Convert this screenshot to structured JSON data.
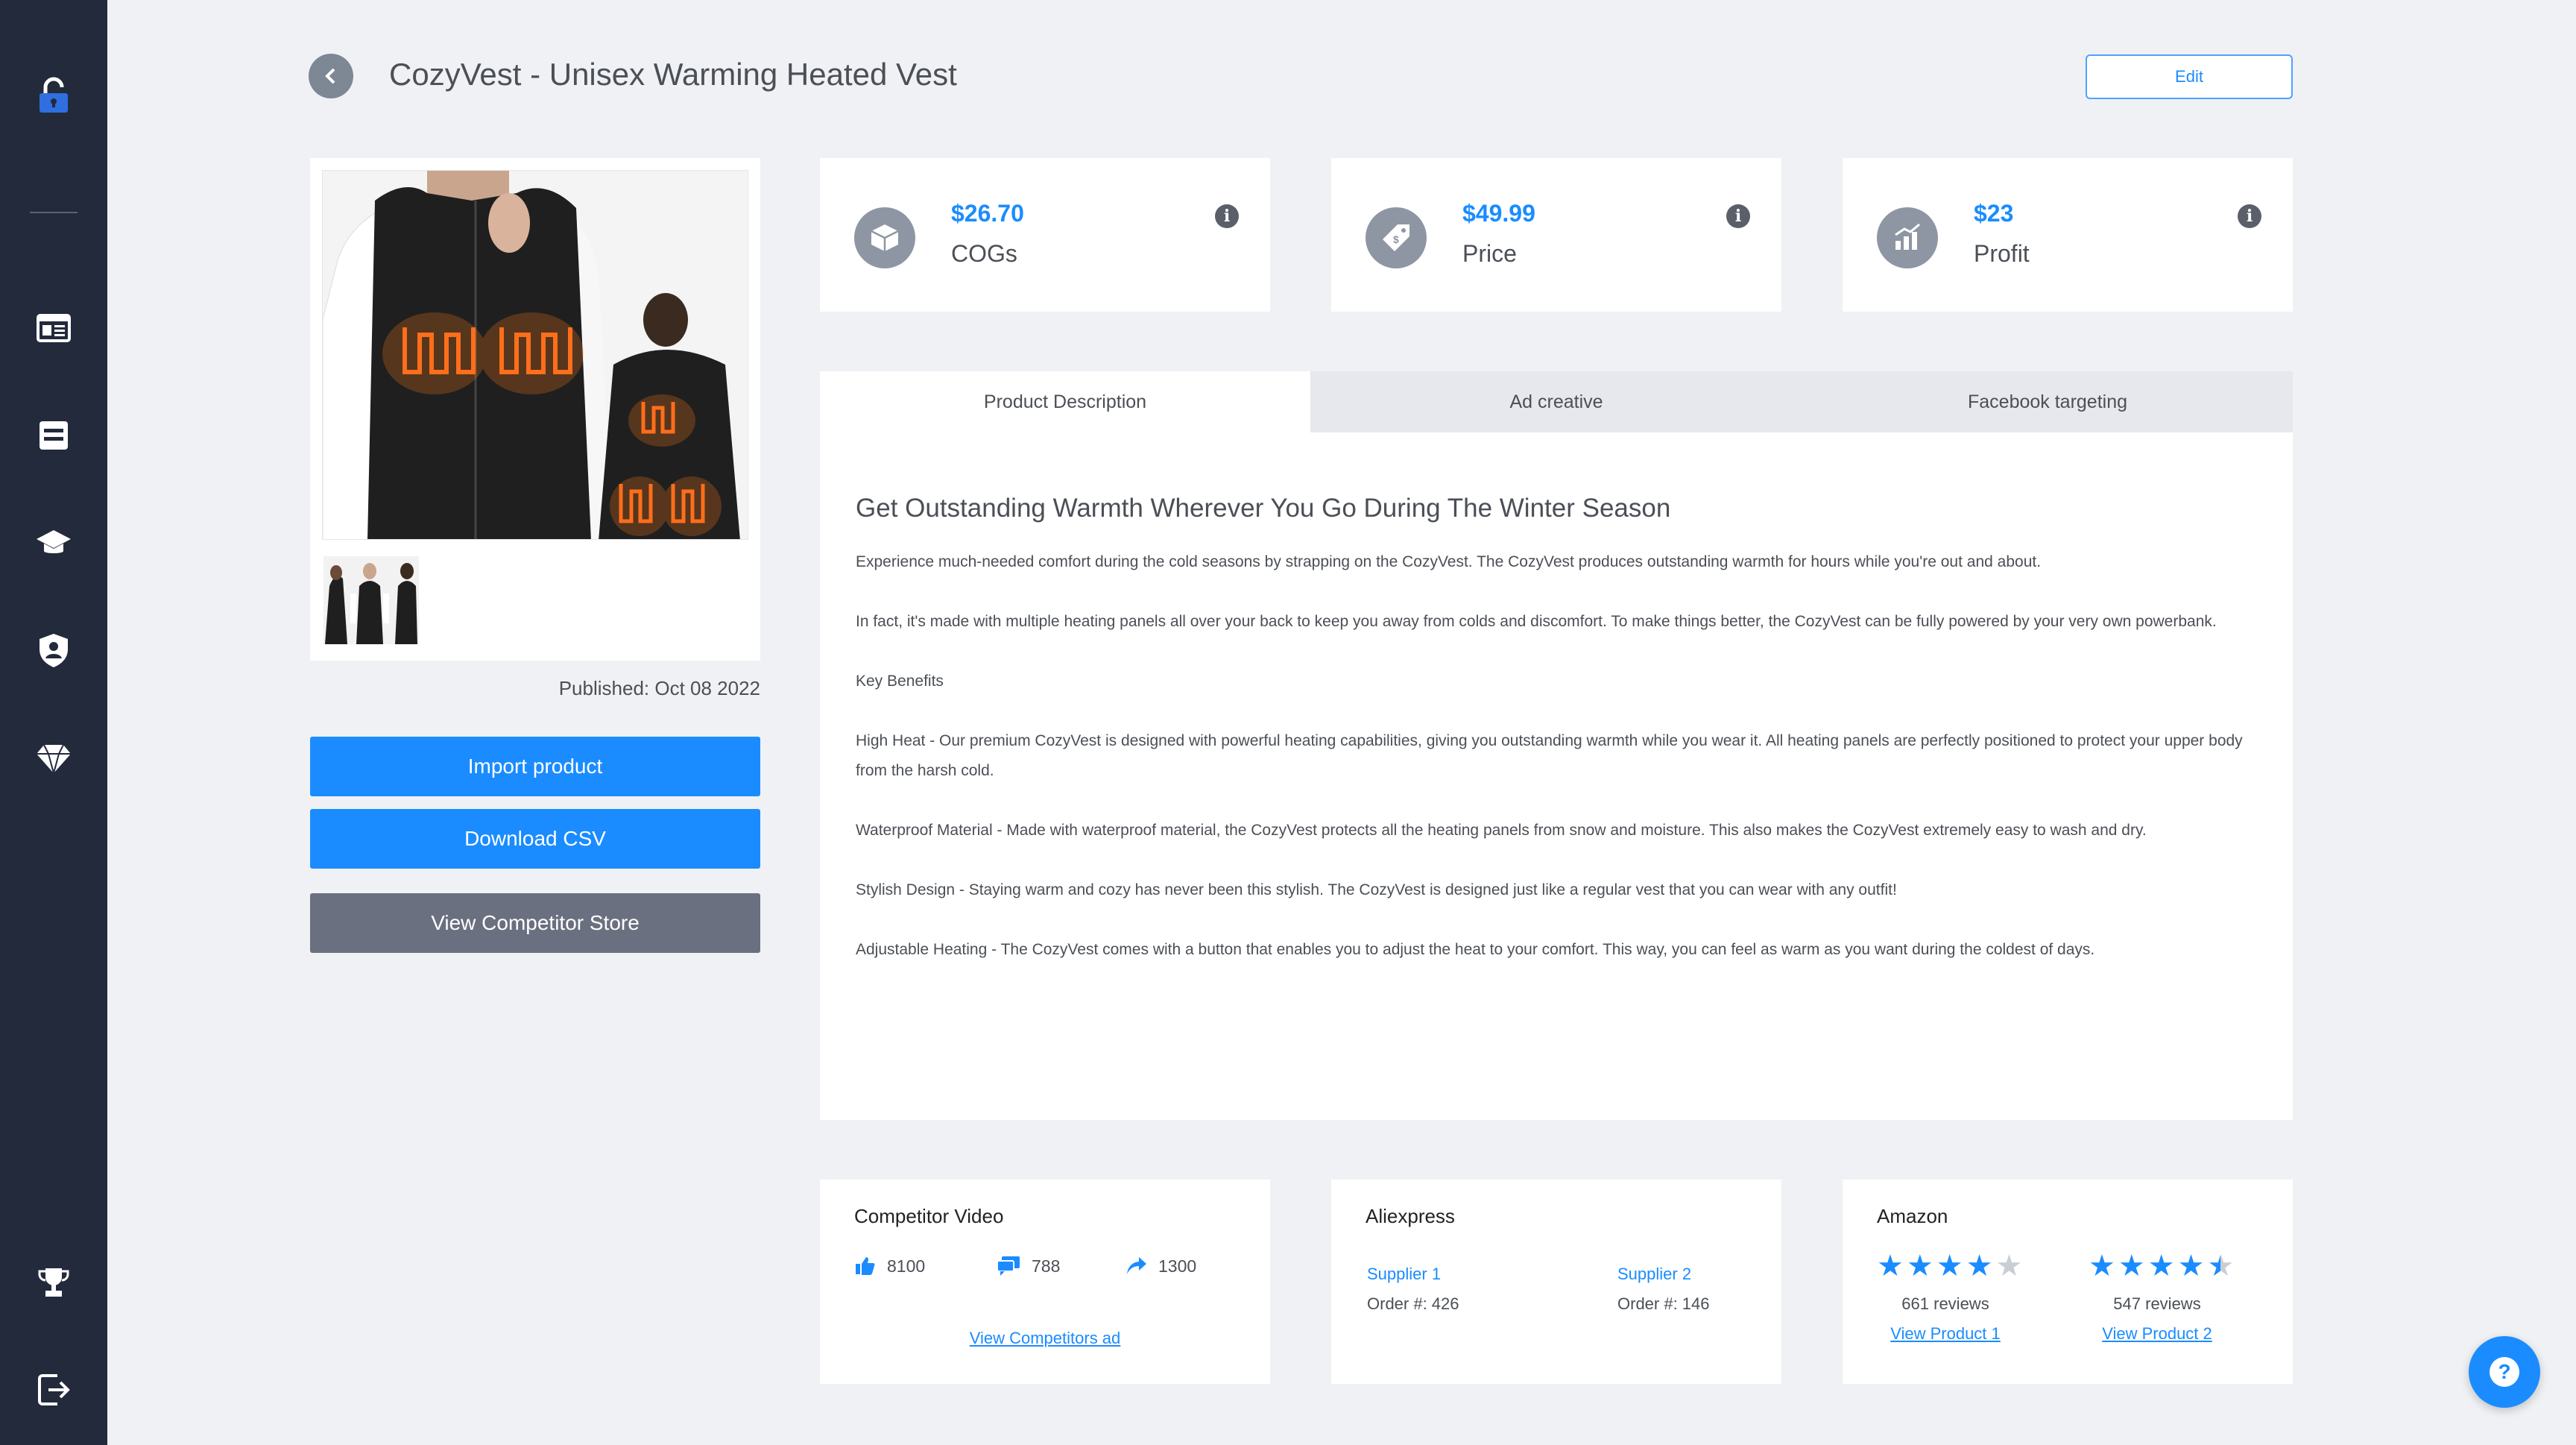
{
  "header": {
    "title": "CozyVest - Unisex Warming Heated Vest",
    "edit_label": "Edit"
  },
  "sidebar": {
    "items": [
      {
        "icon": "lock-open-icon"
      },
      {
        "icon": "dashboard-icon"
      },
      {
        "icon": "list-icon"
      },
      {
        "icon": "graduation-cap-icon"
      },
      {
        "icon": "user-shield-icon"
      },
      {
        "icon": "diamond-icon"
      },
      {
        "icon": "trophy-icon"
      },
      {
        "icon": "sign-out-icon"
      }
    ]
  },
  "product": {
    "published": "Published: Oct 08 2022",
    "buttons": {
      "import": "Import product",
      "download": "Download CSV",
      "competitor": "View Competitor Store"
    }
  },
  "stats": [
    {
      "value": "$26.70",
      "label": "COGs",
      "icon": "box-icon"
    },
    {
      "value": "$49.99",
      "label": "Price",
      "icon": "price-tag-icon"
    },
    {
      "value": "$23",
      "label": "Profit",
      "icon": "chart-icon"
    }
  ],
  "tabs": [
    {
      "label": "Product Description",
      "active": true
    },
    {
      "label": "Ad creative",
      "active": false
    },
    {
      "label": "Facebook targeting",
      "active": false
    }
  ],
  "description": {
    "title": "Get Outstanding Warmth Wherever You Go During The Winter Season",
    "paragraphs": [
      "Experience much-needed comfort during the cold seasons by strapping on the CozyVest. The CozyVest produces outstanding warmth for hours while you're out and about.",
      "In fact, it's made with multiple heating panels all over your back to keep you away from colds and discomfort. To make things better, the CozyVest can be fully powered by your very own powerbank.",
      "Key Benefits",
      "High Heat - Our premium CozyVest is designed with powerful heating capabilities, giving you outstanding warmth while you wear it. All heating panels are perfectly positioned to protect your upper body from the harsh cold.",
      "Waterproof Material - Made with waterproof material, the CozyVest protects all the heating panels from snow and moisture. This also makes the CozyVest extremely easy to wash and dry.",
      "Stylish Design - Staying warm and cozy has never been this stylish. The CozyVest is designed just like a regular vest that you can wear with any outfit!",
      "Adjustable Heating - The CozyVest comes with a button that enables you to adjust the heat to your comfort. This way, you can feel as warm as you want during the coldest of days."
    ]
  },
  "competitor_video": {
    "title": "Competitor Video",
    "likes": "8100",
    "comments": "788",
    "shares": "1300",
    "link": "View Competitors ad"
  },
  "aliexpress": {
    "title": "Aliexpress",
    "suppliers": [
      {
        "name": "Supplier 1",
        "orders": "Order #: 426"
      },
      {
        "name": "Supplier 2",
        "orders": "Order #: 146"
      }
    ]
  },
  "amazon": {
    "title": "Amazon",
    "products": [
      {
        "rating": 4,
        "reviews": "661 reviews",
        "link": "View Product 1"
      },
      {
        "rating": 4.5,
        "reviews": "547 reviews",
        "link": "View Product 2"
      }
    ]
  },
  "colors": {
    "sidebar": "#222a3c",
    "accent": "#1a8cff",
    "gray_button": "#6b7080",
    "background": "#f0f1f4"
  }
}
